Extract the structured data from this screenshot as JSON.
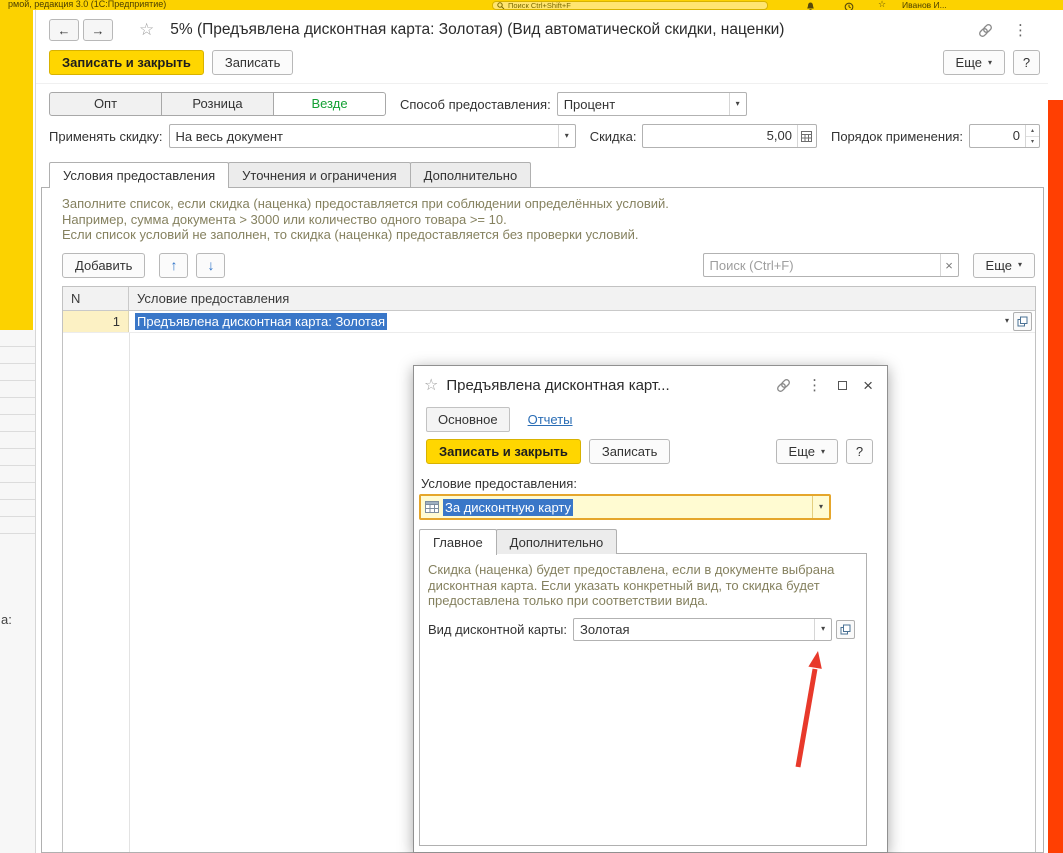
{
  "colors": {
    "brand_yellow": "#ffd600",
    "selection_blue": "#3a77c8",
    "hint_text": "#85815f",
    "link_blue": "#2a6db5",
    "active_green": "#13a033",
    "arrow_red": "#e8392b",
    "side_strip_red": "#ff3f02"
  },
  "titlebar": {
    "title": "рмой, редакция 3.0 (1С:Предприятие)",
    "search_placeholder": "Поиск Ctrl+Shift+F",
    "user": "Иванов И..."
  },
  "main_window": {
    "title": "5% (Предъявлена дисконтная карта: Золотая) (Вид автоматической скидки, наценки)",
    "toolbar": {
      "save_close": "Записать и закрыть",
      "save": "Записать",
      "more": "Еще",
      "help": "?"
    },
    "segments": {
      "items": [
        "Опт",
        "Розница",
        "Везде"
      ],
      "active": "Везде"
    },
    "fields": {
      "method_label": "Способ предоставления:",
      "method_value": "Процент",
      "apply_label": "Применять скидку:",
      "apply_value": "На весь документ",
      "discount_label": "Скидка:",
      "discount_value": "5,00",
      "order_label": "Порядок применения:",
      "order_value": "0"
    },
    "tabs": {
      "items": [
        "Условия предоставления",
        "Уточнения и ограничения",
        "Дополнительно"
      ],
      "active": "Условия предоставления"
    },
    "conditions": {
      "hint_lines": [
        "Заполните список, если скидка (наценка) предоставляется при соблюдении определённых условий.",
        "Например, сумма документа > 3000 или количество одного товара >= 10.",
        "Если список условий не заполнен, то скидка (наценка) предоставляется без проверки условий."
      ],
      "add_button": "Добавить",
      "search_placeholder": "Поиск (Ctrl+F)",
      "more": "Еще",
      "columns": {
        "n": "N",
        "condition": "Условие предоставления"
      },
      "rows": [
        {
          "n": "1",
          "condition": "Предъявлена дисконтная карта: Золотая"
        }
      ]
    }
  },
  "dialog": {
    "title": "Предъявлена дисконтная карт...",
    "nav": [
      "Основное",
      "Отчеты"
    ],
    "toolbar": {
      "save_close": "Записать и закрыть",
      "save": "Записать",
      "more": "Еще",
      "help": "?"
    },
    "condition_label": "Условие предоставления:",
    "condition_value": "За дисконтную карту",
    "tabs": [
      "Главное",
      "Дополнительно"
    ],
    "hint": "Скидка (наценка) будет предоставлена, если в документе выбрана дисконтная карта. Если указать конкретный вид, то скидка будет предоставлена только при соответствии вида.",
    "card_kind_label": "Вид дисконтной карты:",
    "card_kind_value": "Золотая"
  },
  "background": {
    "cut_label": "а:"
  }
}
